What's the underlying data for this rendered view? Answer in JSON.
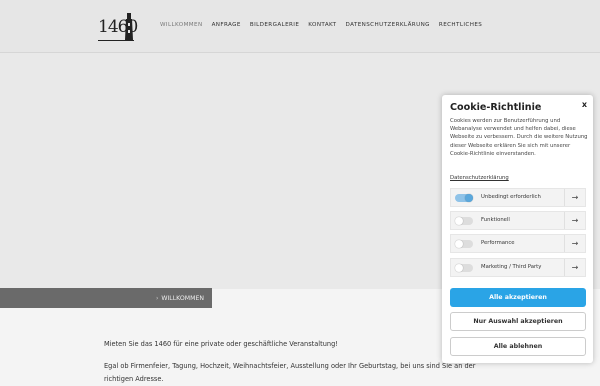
{
  "header": {
    "logo_text": "1460",
    "nav": [
      {
        "label": "WILLKOMMEN",
        "active": true
      },
      {
        "label": "ANFRAGE",
        "active": false
      },
      {
        "label": "BILDERGALERIE",
        "active": false
      },
      {
        "label": "KONTAKT",
        "active": false
      },
      {
        "label": "DATENSCHUTZERKLÄRUNG",
        "active": false
      },
      {
        "label": "RECHTLICHES",
        "active": false
      }
    ]
  },
  "breadcrumb": {
    "separator": "›",
    "label": "WILLKOMMEN"
  },
  "content": {
    "paragraph1": "Mieten Sie das 1460 für eine private oder geschäftliche Veranstaltung!",
    "paragraph2": "Egal ob Firmenfeier, Tagung, Hochzeit, Weihnachtsfeier, Ausstellung oder Ihr Geburtstag, bei uns sind Sie an der",
    "paragraph2b": "richtigen Adresse."
  },
  "cookie": {
    "title": "Cookie-Richtlinie",
    "close": "x",
    "text": "Cookies werden zur Benutzerführung und Webanalyse verwendet und helfen dabei, diese Webseite zu verbessern. Durch die weitere Nutzung dieser Webseite erklären Sie sich mit unserer Cookie-Richtlinie einverstanden.",
    "policy_link": "Datenschutzerklärung",
    "categories": [
      {
        "label": "Unbedingt erforderlich",
        "enabled": true
      },
      {
        "label": "Funktionell",
        "enabled": false
      },
      {
        "label": "Performance",
        "enabled": false
      },
      {
        "label": "Marketing / Third Party",
        "enabled": false
      }
    ],
    "arrow": "→",
    "accept_all": "Alle akzeptieren",
    "accept_selection": "Nur Auswahl akzeptieren",
    "reject_all": "Alle ablehnen"
  },
  "colors": {
    "accent": "#2aa4e6",
    "breadcrumb_bg": "#6a6a6a"
  }
}
